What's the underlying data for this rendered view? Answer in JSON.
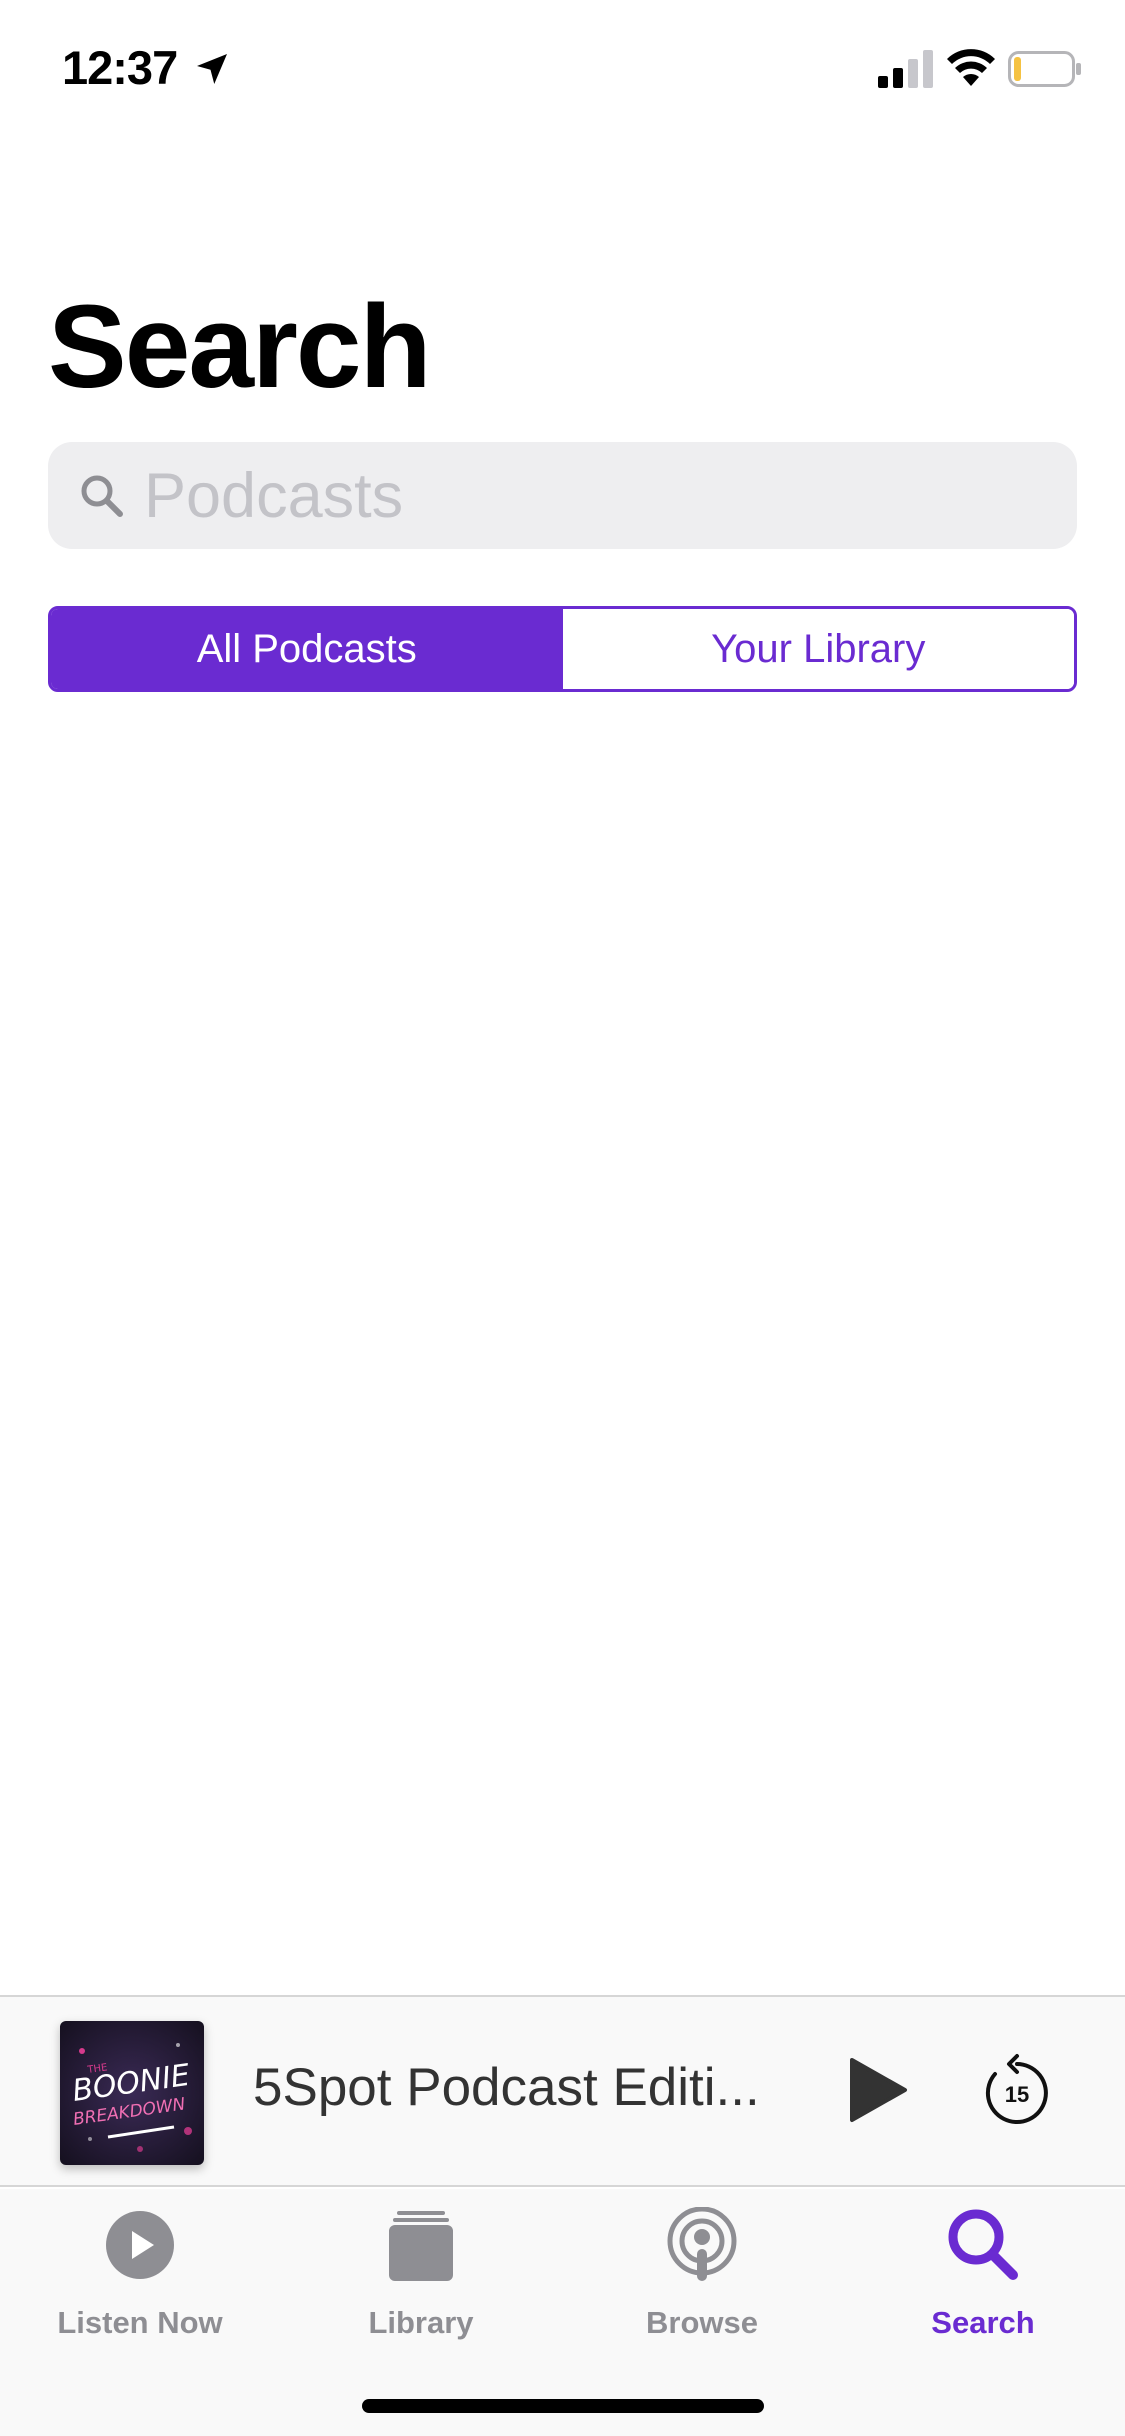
{
  "status_bar": {
    "time": "12:37",
    "icons": [
      "location-arrow-icon",
      "cellular-signal-icon",
      "wifi-icon",
      "battery-icon"
    ]
  },
  "page": {
    "title": "Search"
  },
  "search": {
    "placeholder": "Podcasts",
    "value": "",
    "icon": "magnifying-glass-icon"
  },
  "segmented_control": {
    "segments": [
      {
        "label": "All Podcasts",
        "selected": true
      },
      {
        "label": "Your Library",
        "selected": false
      }
    ]
  },
  "now_playing": {
    "title": "5Spot Podcast Editi...",
    "artwork_text": [
      "THE",
      "BOONIE",
      "BREAKDOWN"
    ],
    "play_icon": "play-icon",
    "skip_back_seconds": "15"
  },
  "tab_bar": {
    "tabs": [
      {
        "label": "Listen Now",
        "icon": "play-circle-icon",
        "active": false
      },
      {
        "label": "Library",
        "icon": "library-stack-icon",
        "active": false
      },
      {
        "label": "Browse",
        "icon": "podcasts-icon",
        "active": false
      },
      {
        "label": "Search",
        "icon": "search-icon",
        "active": true
      }
    ]
  },
  "colors": {
    "accent": "#6a2bd1",
    "inactive_tab": "#8e8e93",
    "search_bg": "#eeeef0",
    "placeholder": "#c3c3c8"
  }
}
